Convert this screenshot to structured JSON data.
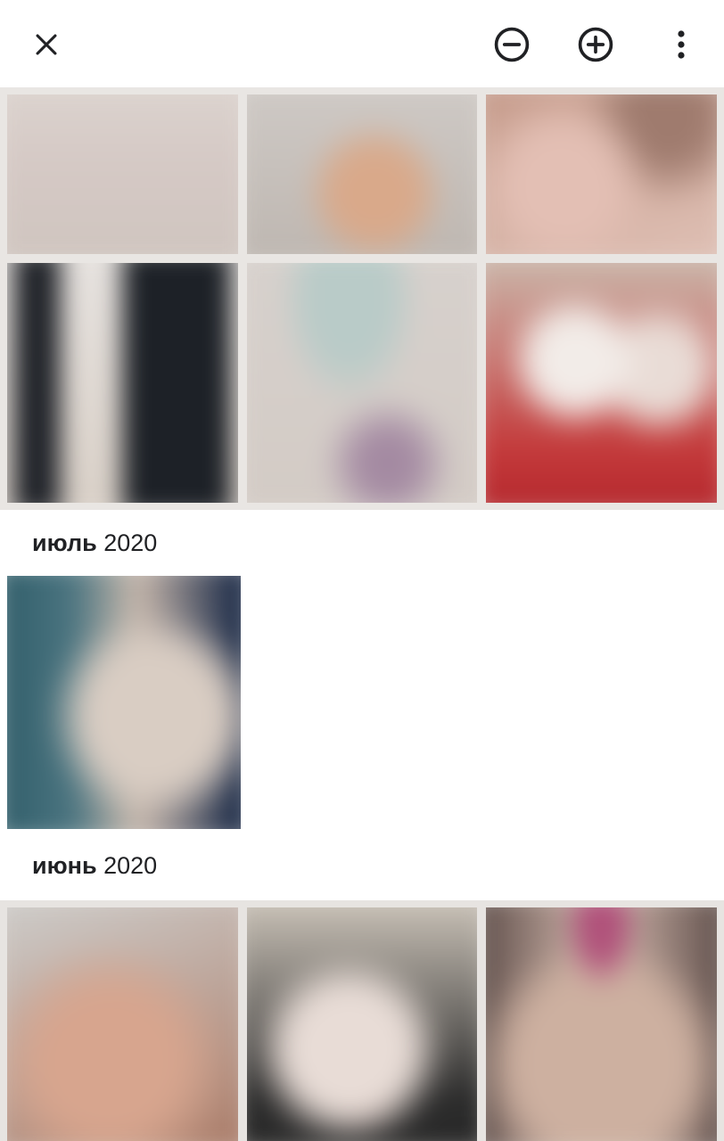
{
  "app_bar": {
    "close_icon": "close-icon",
    "zoom_out_icon": "minus-circle-icon",
    "zoom_in_icon": "plus-circle-icon",
    "more_icon": "more-vertical-icon"
  },
  "sections": [
    {
      "month": "июль",
      "year": "2020",
      "photo_count": 1
    },
    {
      "month": "июнь",
      "year": "2020",
      "photo_count": 3
    }
  ]
}
